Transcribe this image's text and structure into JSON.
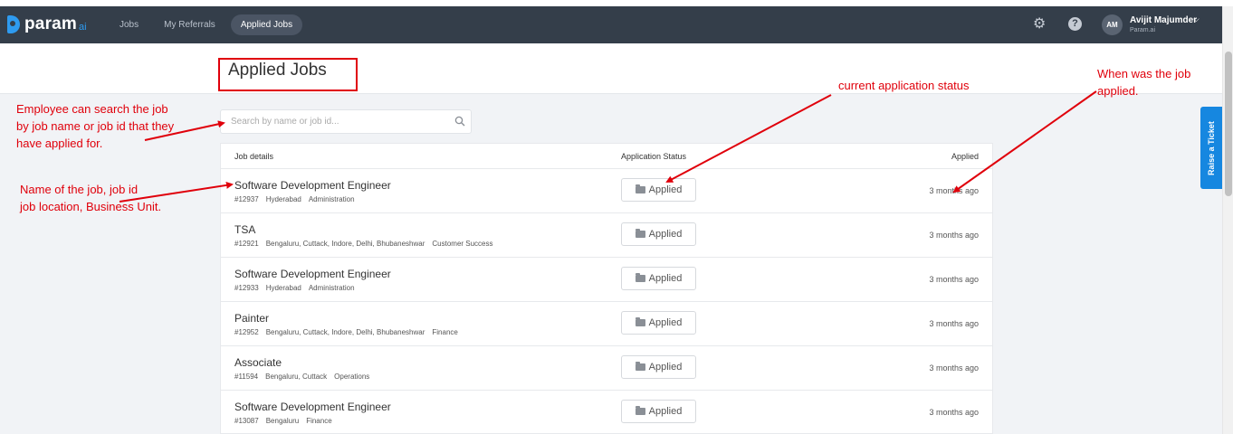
{
  "brand": {
    "name": "param",
    "suffix": "ai"
  },
  "nav": [
    {
      "label": "Jobs",
      "active": false
    },
    {
      "label": "My Referrals",
      "active": false
    },
    {
      "label": "Applied Jobs",
      "active": true
    }
  ],
  "icons": {
    "settings": "gear-icon",
    "help": "help-icon",
    "search": "search-icon",
    "status": "folder-icon",
    "menu": "chevron-down-icon"
  },
  "user": {
    "initials": "AM",
    "name": "Avijit Majumder",
    "org": "Param.ai"
  },
  "page": {
    "title": "Applied Jobs"
  },
  "search": {
    "placeholder": "Search by name or job id..."
  },
  "table": {
    "columns": [
      "Job details",
      "Application Status",
      "Applied"
    ],
    "rows": [
      {
        "title": "Software Development Engineer",
        "id": "#12937",
        "location": "Hyderabad",
        "unit": "Administration",
        "status": "Applied",
        "applied": "3 months ago"
      },
      {
        "title": "TSA",
        "id": "#12921",
        "location": "Bengaluru, Cuttack, Indore, Delhi, Bhubaneshwar",
        "unit": "Customer Success",
        "status": "Applied",
        "applied": "3 months ago"
      },
      {
        "title": "Software Development Engineer",
        "id": "#12933",
        "location": "Hyderabad",
        "unit": "Administration",
        "status": "Applied",
        "applied": "3 months ago"
      },
      {
        "title": "Painter",
        "id": "#12952",
        "location": "Bengaluru, Cuttack, Indore, Delhi, Bhubaneshwar",
        "unit": "Finance",
        "status": "Applied",
        "applied": "3 months ago"
      },
      {
        "title": "Associate",
        "id": "#11594",
        "location": "Bengaluru, Cuttack",
        "unit": "Operations",
        "status": "Applied",
        "applied": "3 months ago"
      },
      {
        "title": "Software Development Engineer",
        "id": "#13087",
        "location": "Bengaluru",
        "unit": "Finance",
        "status": "Applied",
        "applied": "3 months ago"
      }
    ]
  },
  "raise_ticket": {
    "label": "Raise a Ticket"
  },
  "annotations": {
    "search_note": [
      "Employee can search the job",
      "by job name or job id that they",
      "have applied for."
    ],
    "job_note": [
      "Name of the job, job id",
      "job location, Business Unit."
    ],
    "status_note": "current application status",
    "applied_note": [
      "When was the job",
      "applied."
    ]
  },
  "colors": {
    "topbar": "#343e4a",
    "accent": "#2e9bf0",
    "annotation": "#e0000b",
    "raise_ticket": "#1687e0"
  }
}
